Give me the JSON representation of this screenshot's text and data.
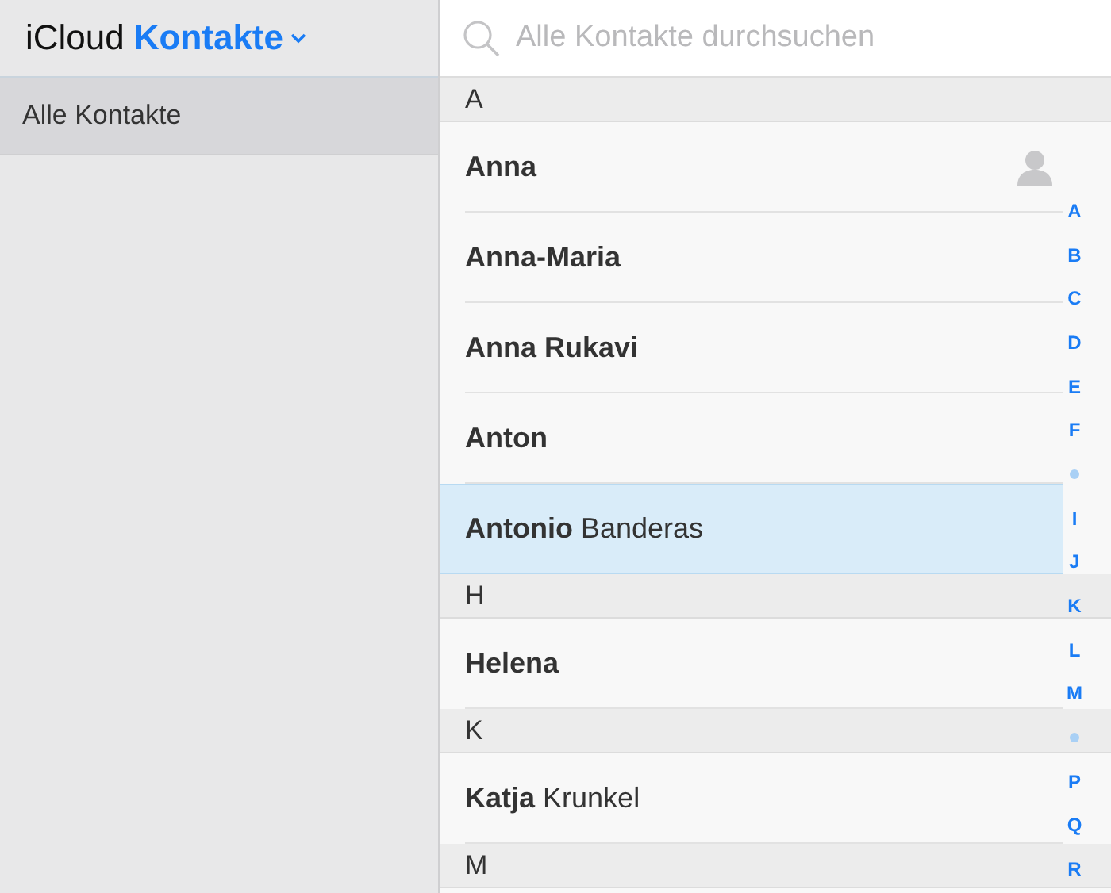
{
  "header": {
    "brand": "iCloud",
    "app": "Kontakte"
  },
  "sidebar": {
    "items": [
      {
        "label": "Alle Kontakte",
        "selected": true
      }
    ]
  },
  "search": {
    "placeholder": "Alle Kontakte durchsuchen"
  },
  "sections": [
    {
      "letter": "A",
      "contacts": [
        {
          "first": "Anna",
          "selected": false,
          "avatar": true
        },
        {
          "first": "Anna-Maria",
          "selected": false,
          "avatar": false
        },
        {
          "first": "Anna Rukavi",
          "selected": false,
          "avatar": false
        },
        {
          "first": "Anton",
          "selected": false,
          "avatar": false
        },
        {
          "first": "Antonio",
          "last": "Banderas",
          "selected": true,
          "avatar": false
        }
      ]
    },
    {
      "letter": "H",
      "contacts": [
        {
          "first": "Helena",
          "selected": false,
          "avatar": false
        }
      ]
    },
    {
      "letter": "K",
      "contacts": [
        {
          "first": "Katja",
          "last": "Krunkel",
          "selected": false,
          "avatar": false
        }
      ]
    },
    {
      "letter": "M"
    }
  ],
  "index": [
    {
      "kind": "letter",
      "label": "A"
    },
    {
      "kind": "letter",
      "label": "B"
    },
    {
      "kind": "letter",
      "label": "C"
    },
    {
      "kind": "letter",
      "label": "D"
    },
    {
      "kind": "letter",
      "label": "E"
    },
    {
      "kind": "letter",
      "label": "F"
    },
    {
      "kind": "dot"
    },
    {
      "kind": "letter",
      "label": "I"
    },
    {
      "kind": "letter",
      "label": "J"
    },
    {
      "kind": "letter",
      "label": "K"
    },
    {
      "kind": "letter",
      "label": "L"
    },
    {
      "kind": "letter",
      "label": "M"
    },
    {
      "kind": "dot"
    },
    {
      "kind": "letter",
      "label": "P"
    },
    {
      "kind": "letter",
      "label": "Q"
    },
    {
      "kind": "letter",
      "label": "R"
    }
  ]
}
